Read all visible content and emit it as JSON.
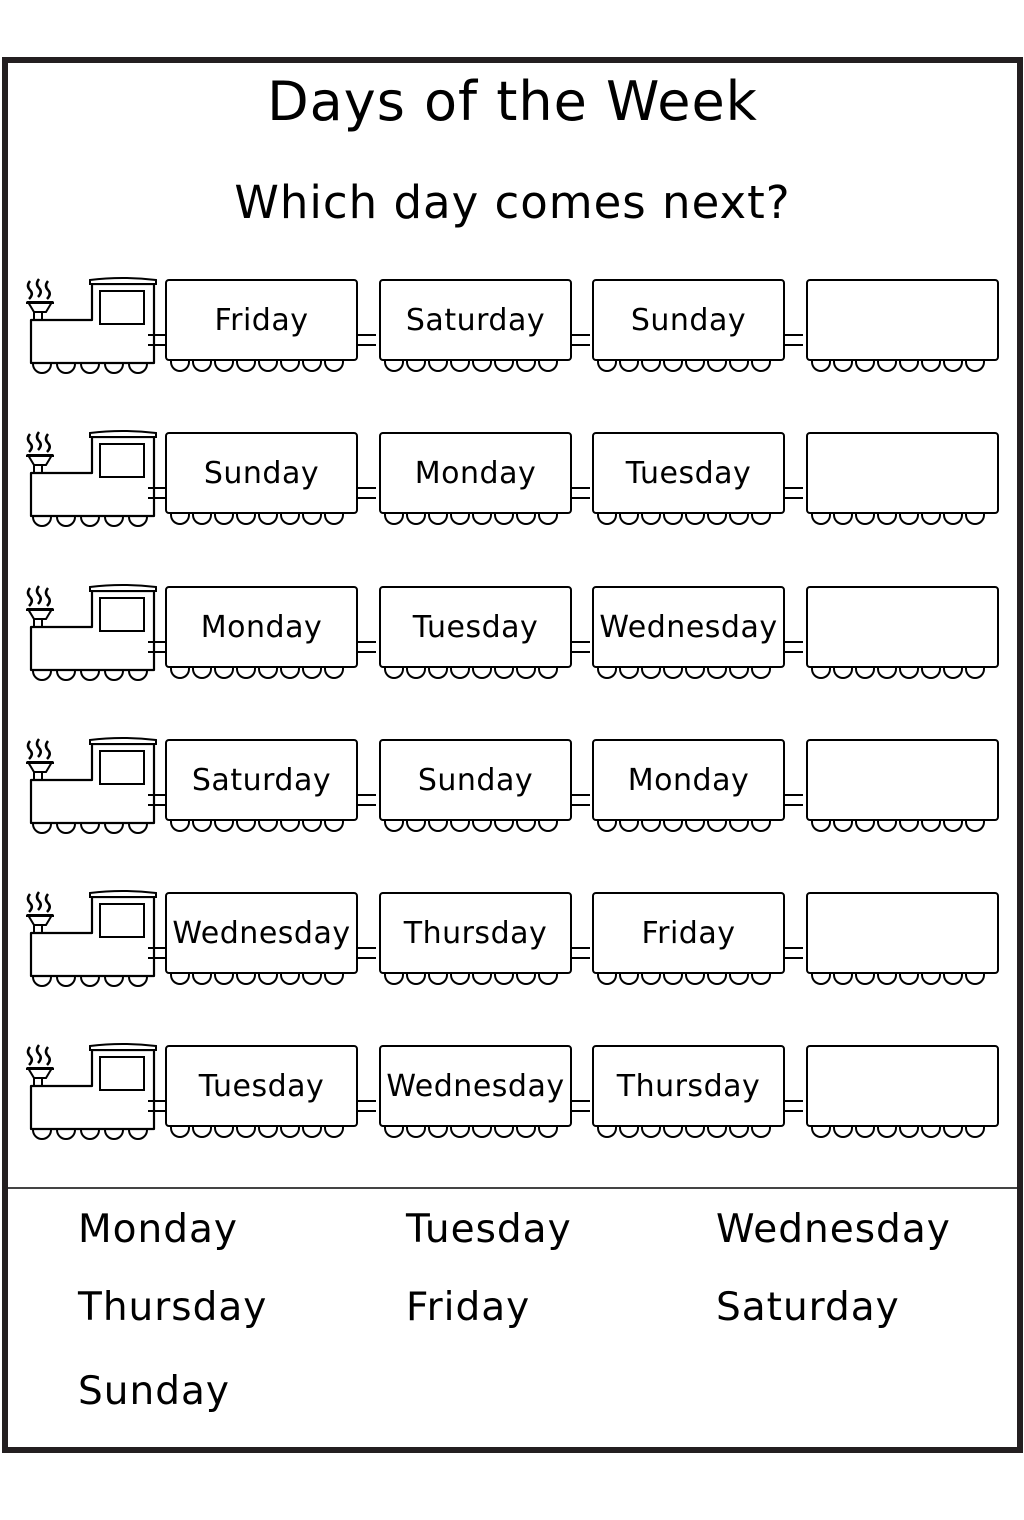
{
  "worksheet": {
    "title": "Days of the Week",
    "subtitle": "Which day comes next?",
    "trains": [
      {
        "cars": [
          "Friday",
          "Saturday",
          "Sunday",
          ""
        ]
      },
      {
        "cars": [
          "Sunday",
          "Monday",
          "Tuesday",
          ""
        ]
      },
      {
        "cars": [
          "Monday",
          "Tuesday",
          "Wednesday",
          ""
        ]
      },
      {
        "cars": [
          "Saturday",
          "Sunday",
          "Monday",
          ""
        ]
      },
      {
        "cars": [
          "Wednesday",
          "Thursday",
          "Friday",
          ""
        ]
      },
      {
        "cars": [
          "Tuesday",
          "Wednesday",
          "Thursday",
          ""
        ]
      }
    ],
    "icons": {
      "engine": "steam-locomotive-icon",
      "wheel": "wheel-icon"
    },
    "word_bank": [
      "Monday",
      "Tuesday",
      "Wednesday",
      "Thursday",
      "Friday",
      "Saturday",
      "Sunday"
    ],
    "colors": {
      "border": "#231f20",
      "ink": "#000000",
      "paper": "#ffffff"
    }
  }
}
